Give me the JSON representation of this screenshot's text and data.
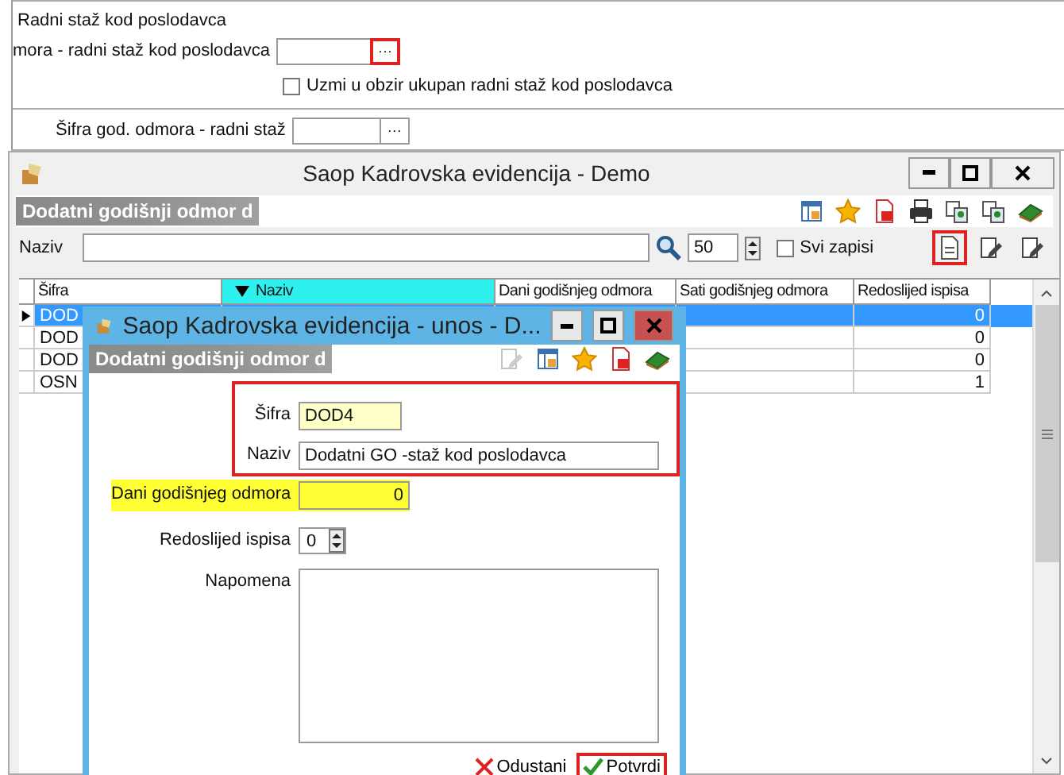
{
  "top_panel": {
    "group_title": "Radni staž kod poslodavca",
    "employer_field": {
      "label": "mora - radni staž kod poslodavca",
      "button": "···",
      "highlighted": true
    },
    "total_checkbox": {
      "label": "Uzmi u obzir ukupan radni staž kod poslodavca",
      "checked": false
    },
    "code_field": {
      "label": "Šifra god. odmora - radni staž",
      "button": "···",
      "highlighted": false
    }
  },
  "main_window": {
    "title": "Saop Kadrovska evidencija  - Demo",
    "header_label": "Dodatni godišnji odmor d",
    "filter": {
      "label": "Naziv",
      "page_size": "50",
      "all_records": {
        "label": "Svi zapisi",
        "checked": false
      },
      "buttons": [
        {
          "kind": "new",
          "highlighted": true
        },
        {
          "kind": "edit",
          "highlighted": false
        },
        {
          "kind": "edit-alt",
          "highlighted": false
        }
      ]
    },
    "table": {
      "columns": [
        {
          "label": "Šifra",
          "sorted": false
        },
        {
          "label": "Naziv",
          "sorted": true
        },
        {
          "label": "Dani godišnjeg odmora",
          "sorted": false
        },
        {
          "label": "Sati godišnjeg odmora",
          "sorted": false
        },
        {
          "label": "Redoslijed ispisa",
          "sorted": false
        }
      ],
      "rows": [
        {
          "code": "DOD",
          "order": "0",
          "selected": true
        },
        {
          "code": "DOD",
          "order": "0",
          "selected": false
        },
        {
          "code": "DOD",
          "order": "0",
          "selected": false
        },
        {
          "code": "OSN",
          "order": "1",
          "selected": false
        }
      ]
    }
  },
  "dialog": {
    "title": "Saop Kadrovska evidencija - unos - D...",
    "header_label": "Dodatni godišnji odmor d",
    "key_fields": {
      "framed": true,
      "items": [
        {
          "label": "Šifra",
          "value": "DOD4",
          "required": true
        },
        {
          "label": "Naziv",
          "value": "Dodatni GO -staž kod poslodavca",
          "required": false
        }
      ]
    },
    "fields": [
      {
        "kind": "number",
        "label": "Dani godišnjeg odmora",
        "value": "0",
        "highlighted": true
      },
      {
        "kind": "spinner",
        "label": "Redoslijed ispisa",
        "value": "0",
        "highlighted": false
      },
      {
        "kind": "memo",
        "label": "Napomena",
        "highlighted": false
      }
    ],
    "buttons": [
      {
        "kind": "cancel",
        "label": "Odustani",
        "highlighted": false
      },
      {
        "kind": "confirm",
        "label": "Potvrdi",
        "highlighted": true
      }
    ]
  }
}
